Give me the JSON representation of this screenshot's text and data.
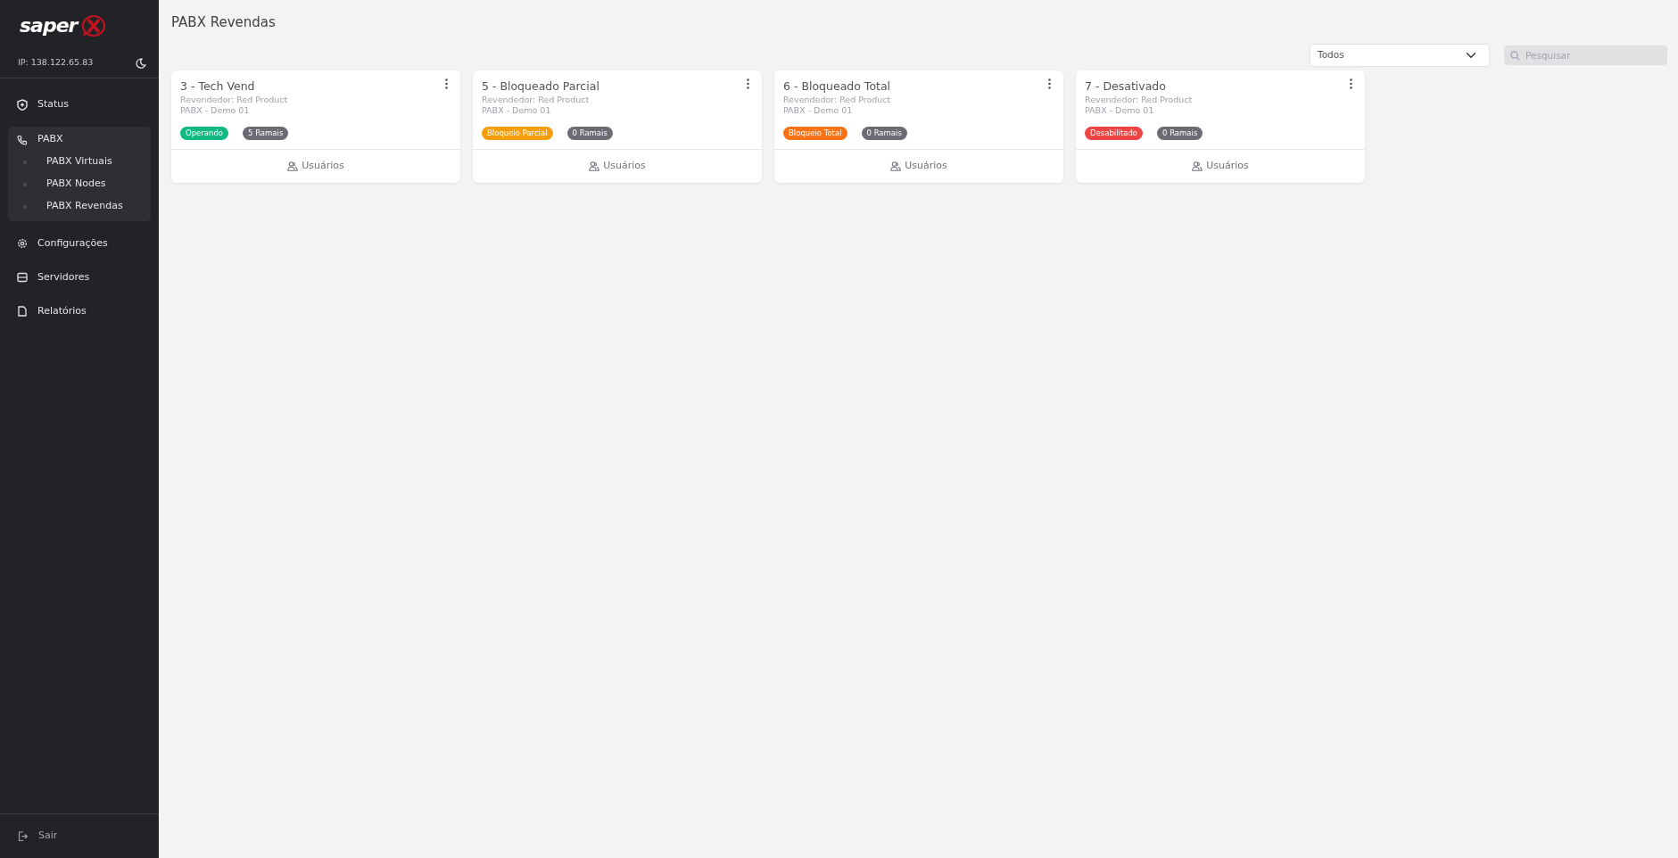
{
  "sidebar": {
    "logo": {
      "word": "saper"
    },
    "ip": "IP: 138.122.65.83",
    "menu": [
      {
        "label": "Status"
      },
      {
        "label": "PABX",
        "expanded": true,
        "children": [
          {
            "label": "PABX Virtuais"
          },
          {
            "label": "PABX Nodes"
          },
          {
            "label": "PABX Revendas"
          }
        ]
      },
      {
        "label": "Configurações"
      },
      {
        "label": "Servidores"
      },
      {
        "label": "Relatórios"
      }
    ],
    "logout": "Sair"
  },
  "page": {
    "title": "PABX Revendas",
    "filter": {
      "value": "Todos"
    },
    "search": {
      "placeholder": "Pesquisar"
    }
  },
  "cards": [
    {
      "title": "3 - Tech Vend",
      "reseller": "Revendedor: Red Product",
      "pabx": "PABX - Demo 01",
      "status": {
        "label": "Operando",
        "color": "#10b981"
      },
      "extensions": "5 Ramais",
      "action": "Usuários"
    },
    {
      "title": "5 - Bloqueado Parcial",
      "reseller": "Revendedor: Red Product",
      "pabx": "PABX - Demo 01",
      "status": {
        "label": "Bloqueio Parcial",
        "color": "#f59e0b"
      },
      "extensions": "0 Ramais",
      "action": "Usuários"
    },
    {
      "title": "6 - Bloqueado Total",
      "reseller": "Revendedor: Red Product",
      "pabx": "PABX - Demo 01",
      "status": {
        "label": "Bloqueio Total",
        "color": "#f97316"
      },
      "extensions": "0 Ramais",
      "action": "Usuários"
    },
    {
      "title": "7 - Desativado",
      "reseller": "Revendedor: Red Product",
      "pabx": "PABX - Demo 01",
      "status": {
        "label": "Desabilitado",
        "color": "#ef4444"
      },
      "extensions": "0 Ramais",
      "action": "Usuários"
    }
  ]
}
